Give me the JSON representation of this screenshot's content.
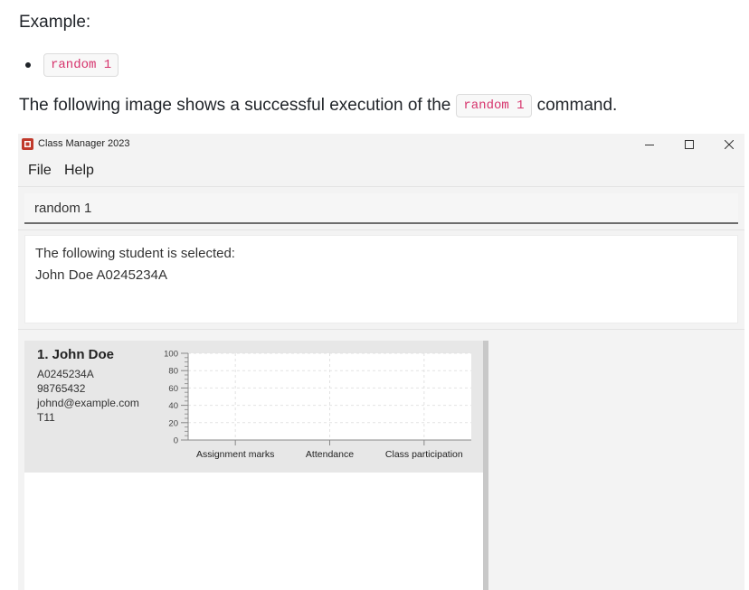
{
  "doc": {
    "heading": "Example:",
    "bullet_code": "random 1",
    "desc_before": "The following image shows a successful execution of the",
    "desc_code": "random 1",
    "desc_after": "command."
  },
  "window": {
    "title": "Class Manager 2023",
    "controls": {
      "minimize": "─",
      "maximize": "☐",
      "close": "✕"
    }
  },
  "menu": {
    "file": "File",
    "help": "Help"
  },
  "command": {
    "value": "random 1"
  },
  "result": {
    "line1": "The following student is selected:",
    "line2": "John Doe A0245234A"
  },
  "student": {
    "index_name": "1.  John Doe",
    "id": "A0245234A",
    "phone": "98765432",
    "email": "johnd@example.com",
    "tutorial": "T11"
  },
  "colors": {
    "card_bg": "#e7e7e7",
    "code_pink": "#d6336c",
    "window_bg": "#f3f3f3"
  },
  "chart_data": {
    "type": "bar",
    "categories": [
      "Assignment marks",
      "Attendance",
      "Class participation"
    ],
    "values": [
      0,
      0,
      0
    ],
    "ylim": [
      0,
      100
    ],
    "yticks": [
      0,
      20,
      40,
      60,
      80,
      100
    ],
    "grid": true
  }
}
